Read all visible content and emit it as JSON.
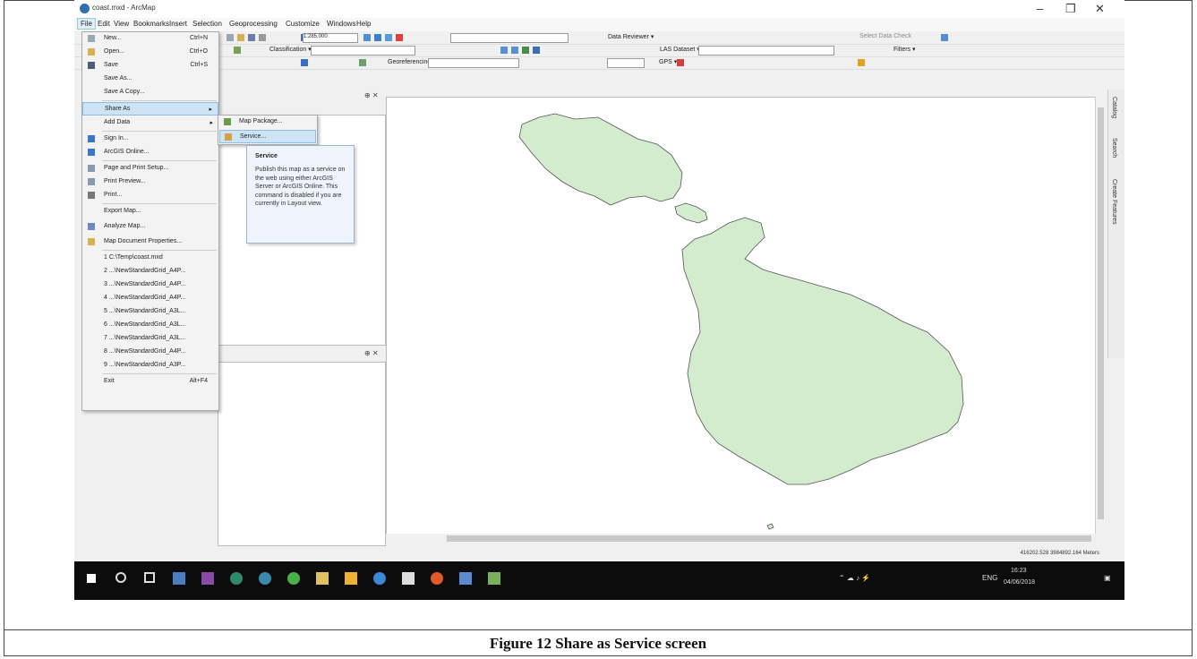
{
  "window": {
    "title": "coast.mxd - ArcMap",
    "minimize": "–",
    "maximize": "❐",
    "close": "✕"
  },
  "menubar": [
    "File",
    "Edit",
    "View",
    "Bookmarks",
    "Insert",
    "Selection",
    "Geoprocessing",
    "Customize",
    "Windows",
    "Help"
  ],
  "toolbar": {
    "scale": "1:285,000",
    "data_reviewer": "Data Reviewer ▾",
    "select_data_check": "Select Data Check",
    "classification": "Classification ▾",
    "las_dataset": "LAS Dataset ▾",
    "filters": "Filters ▾",
    "georeferencing": "Georeferencing ▾",
    "gps": "GPS ▾"
  },
  "file_menu": {
    "items": [
      {
        "label": "New...",
        "shortcut": "Ctrl+N"
      },
      {
        "label": "Open...",
        "shortcut": "Ctrl+O"
      },
      {
        "label": "Save",
        "shortcut": "Ctrl+S"
      },
      {
        "label": "Save As...",
        "shortcut": ""
      },
      {
        "label": "Save A Copy...",
        "shortcut": ""
      },
      {
        "label": "Share As",
        "shortcut": ""
      },
      {
        "label": "Add Data",
        "shortcut": ""
      },
      {
        "label": "Sign In...",
        "shortcut": ""
      },
      {
        "label": "ArcGIS Online...",
        "shortcut": ""
      },
      {
        "label": "Page and Print Setup...",
        "shortcut": ""
      },
      {
        "label": "Print Preview...",
        "shortcut": ""
      },
      {
        "label": "Print...",
        "shortcut": ""
      },
      {
        "label": "Export Map...",
        "shortcut": ""
      },
      {
        "label": "Analyze Map...",
        "shortcut": ""
      },
      {
        "label": "Map Document Properties...",
        "shortcut": ""
      },
      {
        "label": "1 C:\\Temp\\coast.mxd",
        "shortcut": ""
      },
      {
        "label": "2 ...\\NewStandardGrid_A4P...",
        "shortcut": ""
      },
      {
        "label": "3 ...\\NewStandardGrid_A4P...",
        "shortcut": ""
      },
      {
        "label": "4 ...\\NewStandardGrid_A4P...",
        "shortcut": ""
      },
      {
        "label": "5 ...\\NewStandardGrid_A3L...",
        "shortcut": ""
      },
      {
        "label": "6 ...\\NewStandardGrid_A3L...",
        "shortcut": ""
      },
      {
        "label": "7 ...\\NewStandardGrid_A3L...",
        "shortcut": ""
      },
      {
        "label": "8 ...\\NewStandardGrid_A4P...",
        "shortcut": ""
      },
      {
        "label": "9 ...\\NewStandardGrid_A3P...",
        "shortcut": ""
      },
      {
        "label": "Exit",
        "shortcut": "Alt+F4"
      }
    ]
  },
  "share_submenu": {
    "items": [
      "Map Package...",
      "Service..."
    ]
  },
  "tooltip": {
    "title": "Service",
    "body": "Publish this map as a service on the web using either ArcGIS Server or ArcGIS Online. This command is disabled if you are currently in Layout view."
  },
  "dock_tabs": [
    "Catalog",
    "Search",
    "Create Features"
  ],
  "status": {
    "coordinates": "416202.528  3984892.164 Meters"
  },
  "taskbar": {
    "language": "ENG",
    "time": "16:23",
    "date": "04/06/2018"
  },
  "map": {
    "fill_color": "#d4ecce",
    "stroke_color": "#555555"
  },
  "caption": "Figure 12 Share as Service screen"
}
